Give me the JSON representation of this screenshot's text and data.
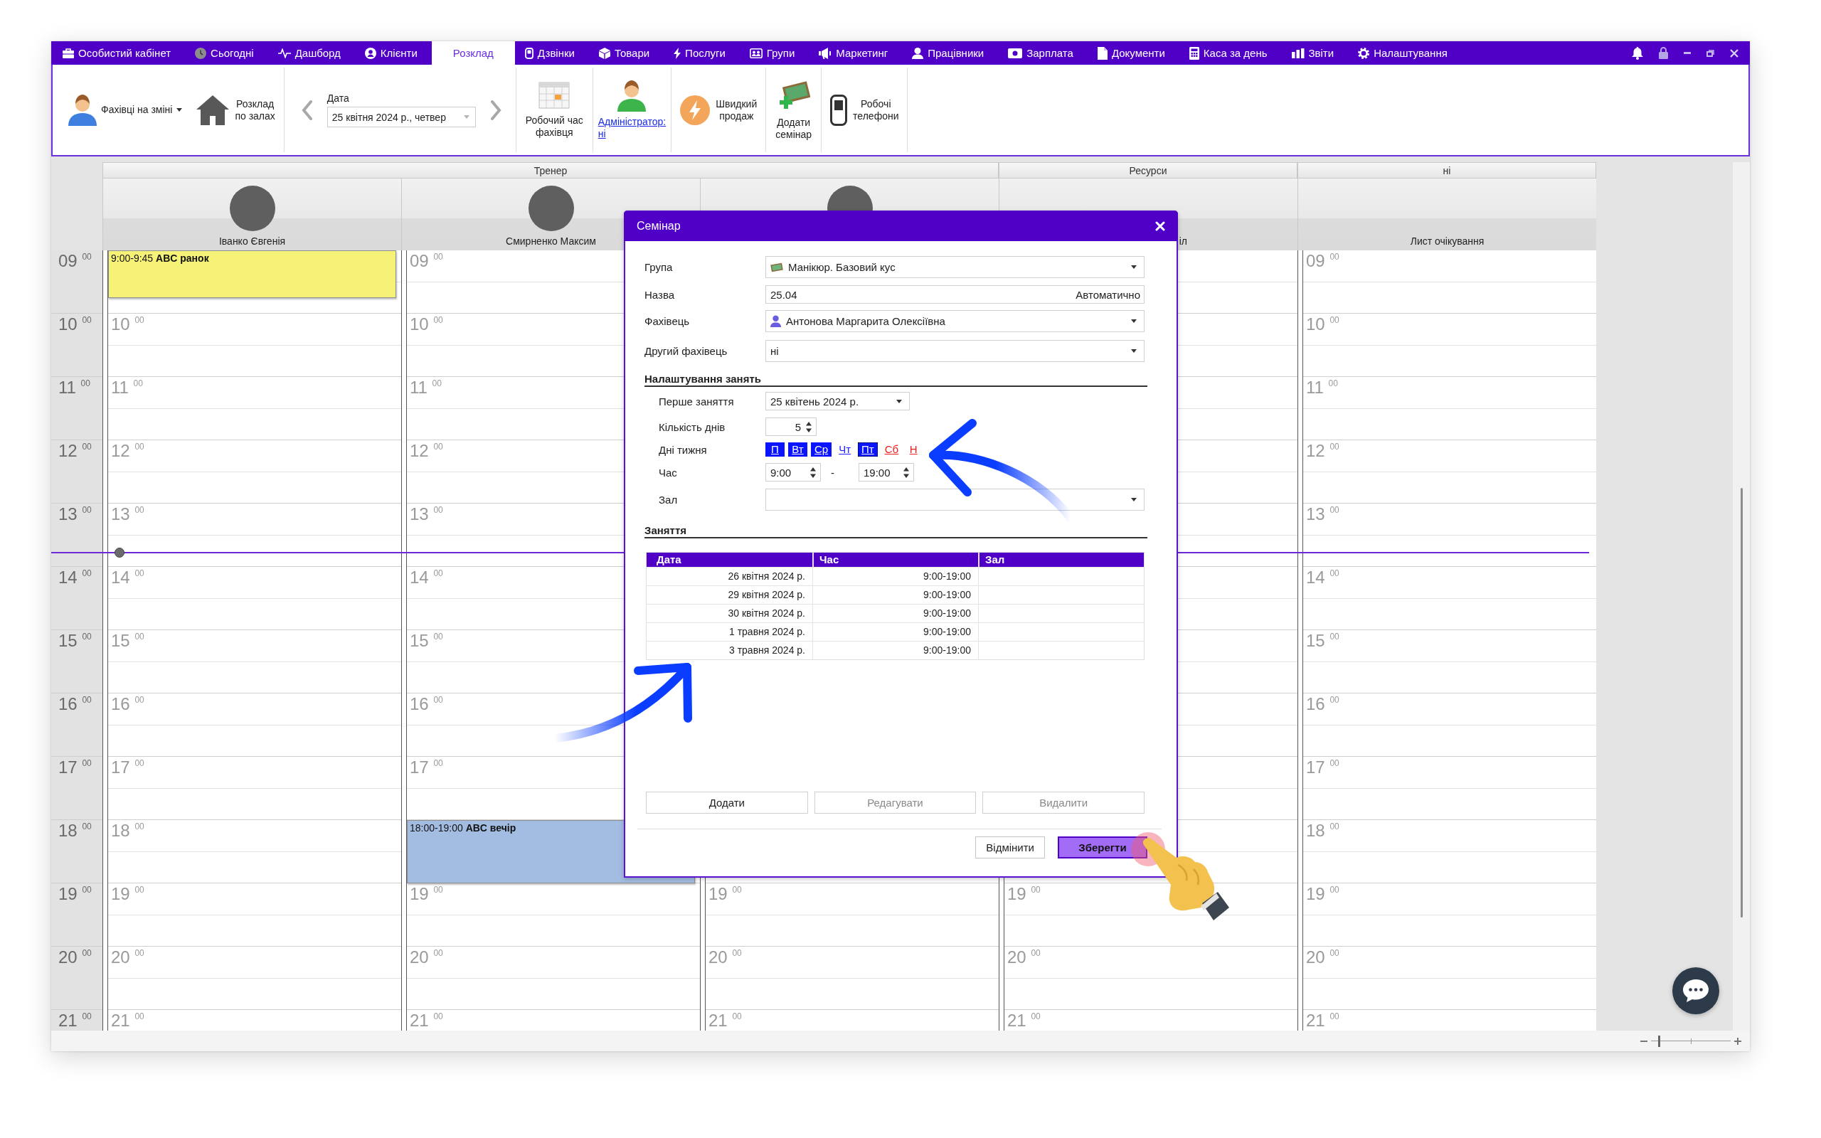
{
  "menu": {
    "items": [
      {
        "label": "Особистий кабінет",
        "selected": false
      },
      {
        "label": "Сьогодні",
        "selected": false
      },
      {
        "label": "Дашборд",
        "selected": false
      },
      {
        "label": "Клієнти",
        "selected": false
      },
      {
        "label": "Розклад",
        "selected": true
      },
      {
        "label": "Дзвінки",
        "selected": false
      },
      {
        "label": "Товари",
        "selected": false
      },
      {
        "label": "Послуги",
        "selected": false
      },
      {
        "label": "Групи",
        "selected": false
      },
      {
        "label": "Маркетинг",
        "selected": false
      },
      {
        "label": "Працівники",
        "selected": false
      },
      {
        "label": "Зарплата",
        "selected": false
      },
      {
        "label": "Документи",
        "selected": false
      },
      {
        "label": "Каса за день",
        "selected": false
      },
      {
        "label": "Звіти",
        "selected": false
      },
      {
        "label": "Налаштування",
        "selected": false
      }
    ]
  },
  "toolbar": {
    "staff": {
      "label": "Фахівці на зміні"
    },
    "halls": {
      "label": "Розклад\nпо залах"
    },
    "date": {
      "label": "Дата",
      "value": "25 квітня 2024 р., четвер"
    },
    "actions": [
      {
        "kind": "stacked",
        "label": "Робочий час\nфахівця"
      },
      {
        "kind": "link",
        "label": "Адміністратор:\nні"
      },
      {
        "kind": "inline",
        "label": "Швидкий\nпродаж"
      },
      {
        "kind": "stacked",
        "label": "Додати\nсемінар"
      },
      {
        "kind": "inline",
        "label": "Робочі\nтелефони"
      }
    ]
  },
  "schedule": {
    "hours": [
      {
        "label": "09 $^{00}$",
        "now": false
      },
      {
        "label": "10 $^{00}$",
        "now": false
      },
      {
        "label": "11 $^{00}$",
        "now": false
      },
      {
        "label": "12 $^{00}$",
        "now": false
      },
      {
        "label": "13 $^{00}$",
        "now": true
      },
      {
        "label": "14 $^{00}$",
        "now": false
      },
      {
        "label": "15 $^{00}$",
        "now": false
      },
      {
        "label": "16 $^{00}$",
        "now": false
      },
      {
        "label": "17 $^{00}$",
        "now": false
      },
      {
        "label": "18 $^{00}$",
        "now": false
      },
      {
        "label": "19 $^{00}$",
        "now": false
      },
      {
        "label": "20 $^{00}$",
        "now": false
      },
      {
        "label": "21 $^{00}$",
        "now": false
      }
    ],
    "groups": [
      {
        "label": "Тренер",
        "columns": [
          {
            "name": "Іванко Євгенія",
            "avatar": true,
            "cells": [
              {
                "kind": "event",
                "label": "9:00-9:45 **ABC ранок**",
                "color": "#f5f277"
              },
              {
                "kind": "slot",
                "label": "10 $^{00}$"
              },
              {
                "kind": "slot",
                "label": "11 $^{00}$"
              },
              {
                "kind": "slot",
                "label": "12 $^{00}$"
              },
              {
                "kind": "slot",
                "label": "13 $^{00}$"
              },
              {
                "kind": "slot",
                "label": "14 $^{00}$"
              },
              {
                "kind": "slot",
                "label": "15 $^{00}$"
              },
              {
                "kind": "slot",
                "label": "16 $^{00}$"
              },
              {
                "kind": "slot",
                "label": "17 $^{00}$"
              },
              {
                "kind": "slot",
                "label": "18 $^{00}$"
              },
              {
                "kind": "slot",
                "label": "19 $^{00}$"
              },
              {
                "kind": "slot",
                "label": "20 $^{00}$"
              },
              {
                "kind": "slot",
                "label": "21 $^{00}$"
              }
            ]
          },
          {
            "name": "Смирненко Максим",
            "avatar": true,
            "cells": [
              {
                "kind": "slot",
                "label": "09 $^{00}$"
              },
              {
                "kind": "slot",
                "label": "10 $^{00}$"
              },
              {
                "kind": "slot",
                "label": "11 $^{00}$"
              },
              {
                "kind": "slot",
                "label": "12 $^{00}$"
              },
              {
                "kind": "slot",
                "label": "13 $^{00}$"
              },
              {
                "kind": "slot",
                "label": "14 $^{00}$"
              },
              {
                "kind": "slot",
                "label": "15 $^{00}$"
              },
              {
                "kind": "slot",
                "label": "16 $^{00}$"
              },
              {
                "kind": "slot",
                "label": "17 $^{00}$"
              },
              {
                "kind": "event",
                "label": "18:00-19:00 **ABC вечір**",
                "color": "#a3bde2"
              },
              {
                "kind": "slot",
                "label": "19 $^{00}$"
              },
              {
                "kind": "slot",
                "label": "20 $^{00}$"
              },
              {
                "kind": "slot",
                "label": "21 $^{00}$"
              }
            ]
          },
          {
            "avatar": true,
            "cells": [
              {
                "kind": "slot",
                "label": "19 $^{00}$"
              },
              {
                "kind": "slot",
                "label": "20 $^{00}$"
              },
              {
                "kind": "slot",
                "label": "21 $^{00}$"
              }
            ]
          }
        ]
      },
      {
        "label": "Ресурси",
        "columns": [
          {
            "name": "іл",
            "name_clipped": true,
            "cells": [
              {
                "kind": "slot",
                "label": "19 $^{00}$"
              },
              {
                "kind": "slot",
                "label": "20 $^{00}$"
              },
              {
                "kind": "slot",
                "label": "21 $^{00}$"
              }
            ]
          }
        ]
      },
      {
        "label": "ні",
        "columns": [
          {
            "name": "Лист очікування",
            "cells": [
              {
                "kind": "slot",
                "label": "09 $^{00}$"
              },
              {
                "kind": "slot",
                "label": "10 $^{00}$"
              },
              {
                "kind": "slot",
                "label": "11 $^{00}$"
              },
              {
                "kind": "slot",
                "label": "12 $^{00}$"
              },
              {
                "kind": "slot",
                "label": "13 $^{00}$"
              },
              {
                "kind": "slot",
                "label": "14 $^{00}$"
              },
              {
                "kind": "slot",
                "label": "15 $^{00}$"
              },
              {
                "kind": "slot",
                "label": "16 $^{00}$"
              },
              {
                "kind": "slot",
                "label": "17 $^{00}$"
              },
              {
                "kind": "slot",
                "label": "18 $^{00}$"
              },
              {
                "kind": "slot",
                "label": "19 $^{00}$"
              },
              {
                "kind": "slot",
                "label": "20 $^{00}$"
              },
              {
                "kind": "slot",
                "label": "21 $^{00}$"
              }
            ]
          }
        ]
      }
    ]
  },
  "dialog": {
    "title": "Семінар",
    "fields": [
      {
        "kind": "group_select",
        "label": "Група",
        "value": "Манікюр. Базовий кус"
      },
      {
        "kind": "text",
        "label": "Назва",
        "value": "25.04",
        "suffix": "Автоматично"
      },
      {
        "kind": "person_select",
        "label": "Фахівець",
        "value": "Антонова Маргарита Олексіївна"
      },
      {
        "kind": "select",
        "label": "Другий фахівець",
        "value": "ні"
      }
    ],
    "settings": {
      "title": "Налаштування занять",
      "first_lesson": {
        "label": "Перше заняття",
        "value": "25 квітень 2024 р."
      },
      "day_count": {
        "label": "Кількість днів",
        "value": "5"
      },
      "weekdays": {
        "label": "Дні тижня",
        "days": [
          {
            "label": "П",
            "selected": true,
            "weekend": false,
            "focused": false
          },
          {
            "label": "Вт",
            "selected": true,
            "weekend": false,
            "focused": false
          },
          {
            "label": "Ср",
            "selected": true,
            "weekend": false,
            "focused": false
          },
          {
            "label": "Чт",
            "selected": false,
            "weekend": false,
            "focused": false
          },
          {
            "label": "Пт",
            "selected": true,
            "weekend": false,
            "focused": true
          },
          {
            "label": "Сб",
            "selected": false,
            "weekend": true,
            "focused": false
          },
          {
            "label": "Н",
            "selected": false,
            "weekend": true,
            "focused": false
          }
        ]
      },
      "time": {
        "label": "Час",
        "from": "9:00",
        "separator": "-",
        "to": "19:00"
      },
      "hall": {
        "label": "Зал"
      }
    },
    "lessons": {
      "title": "Заняття",
      "columns": [
        "Дата",
        "Час",
        "Зал"
      ],
      "rows": [
        [
          "26 квітня 2024 р.",
          "9:00-19:00"
        ],
        [
          "29 квітня 2024 р.",
          "9:00-19:00"
        ],
        [
          "30 квітня 2024 р.",
          "9:00-19:00"
        ],
        [
          "1 травня 2024 р.",
          "9:00-19:00"
        ],
        [
          "3 травня 2024 р.",
          "9:00-19:00"
        ]
      ]
    },
    "row_actions": [
      {
        "label": "Додати",
        "disabled": false
      },
      {
        "label": "Редагувати",
        "disabled": true
      },
      {
        "label": "Видалити",
        "disabled": true
      }
    ],
    "buttons": [
      {
        "kind": "secondary",
        "label": "Відмінити"
      },
      {
        "kind": "primary",
        "label": "Зберегти"
      }
    ]
  },
  "zoom": {
    "level": 0.1
  }
}
